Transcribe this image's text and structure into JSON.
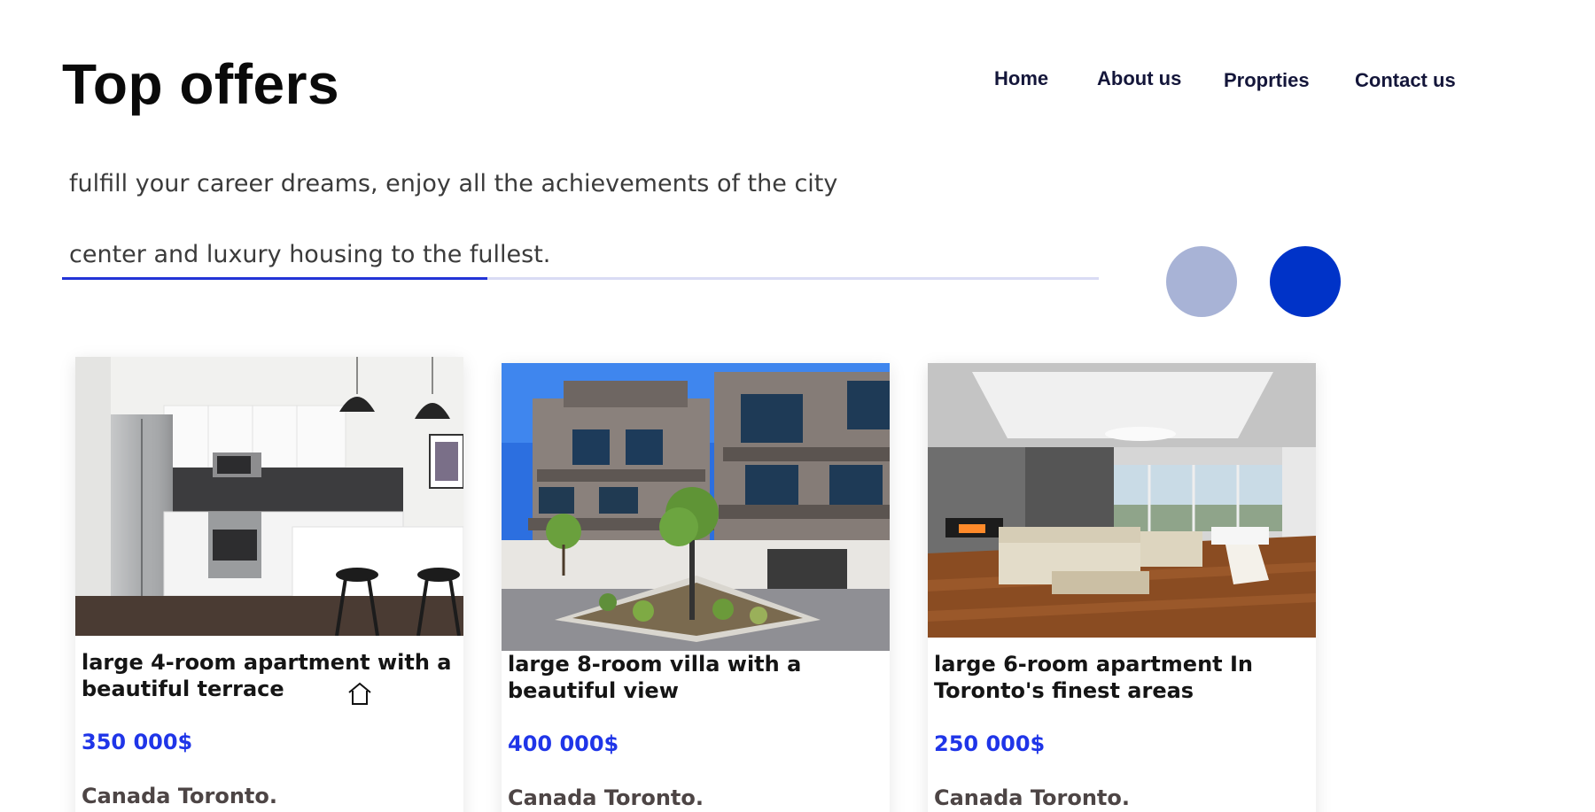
{
  "header": {
    "title": "Top offers"
  },
  "nav": {
    "items": [
      "Home",
      "About us",
      "Proprties",
      "Contact us"
    ]
  },
  "intro": {
    "line1": "fulfill your career dreams, enjoy all the achievements of the city",
    "line2": "center and luxury housing to the fullest."
  },
  "slider": {
    "progress": 0.41,
    "colors": {
      "track": "#d9dbf4",
      "fill": "#2233d6",
      "prev_button": "#a8b3d6",
      "next_button": "#0033c8"
    }
  },
  "colors": {
    "price": "#1f35e8",
    "nav_text": "#14163a",
    "title": "#0a0a0a"
  },
  "cards": [
    {
      "image": "kitchen-photo",
      "name": "large 4-room apartment with a beautiful terrace",
      "price": "350 000$",
      "location": "Canada Toronto.",
      "icon": "house-icon"
    },
    {
      "image": "villa-exterior-photo",
      "name": "large 8-room villa with a beautiful view",
      "price": "400 000$",
      "location": "Canada Toronto."
    },
    {
      "image": "living-room-photo",
      "name": "large 6-room apartment In Toronto's finest areas",
      "price": "250 000$",
      "location": "Canada Toronto."
    }
  ]
}
